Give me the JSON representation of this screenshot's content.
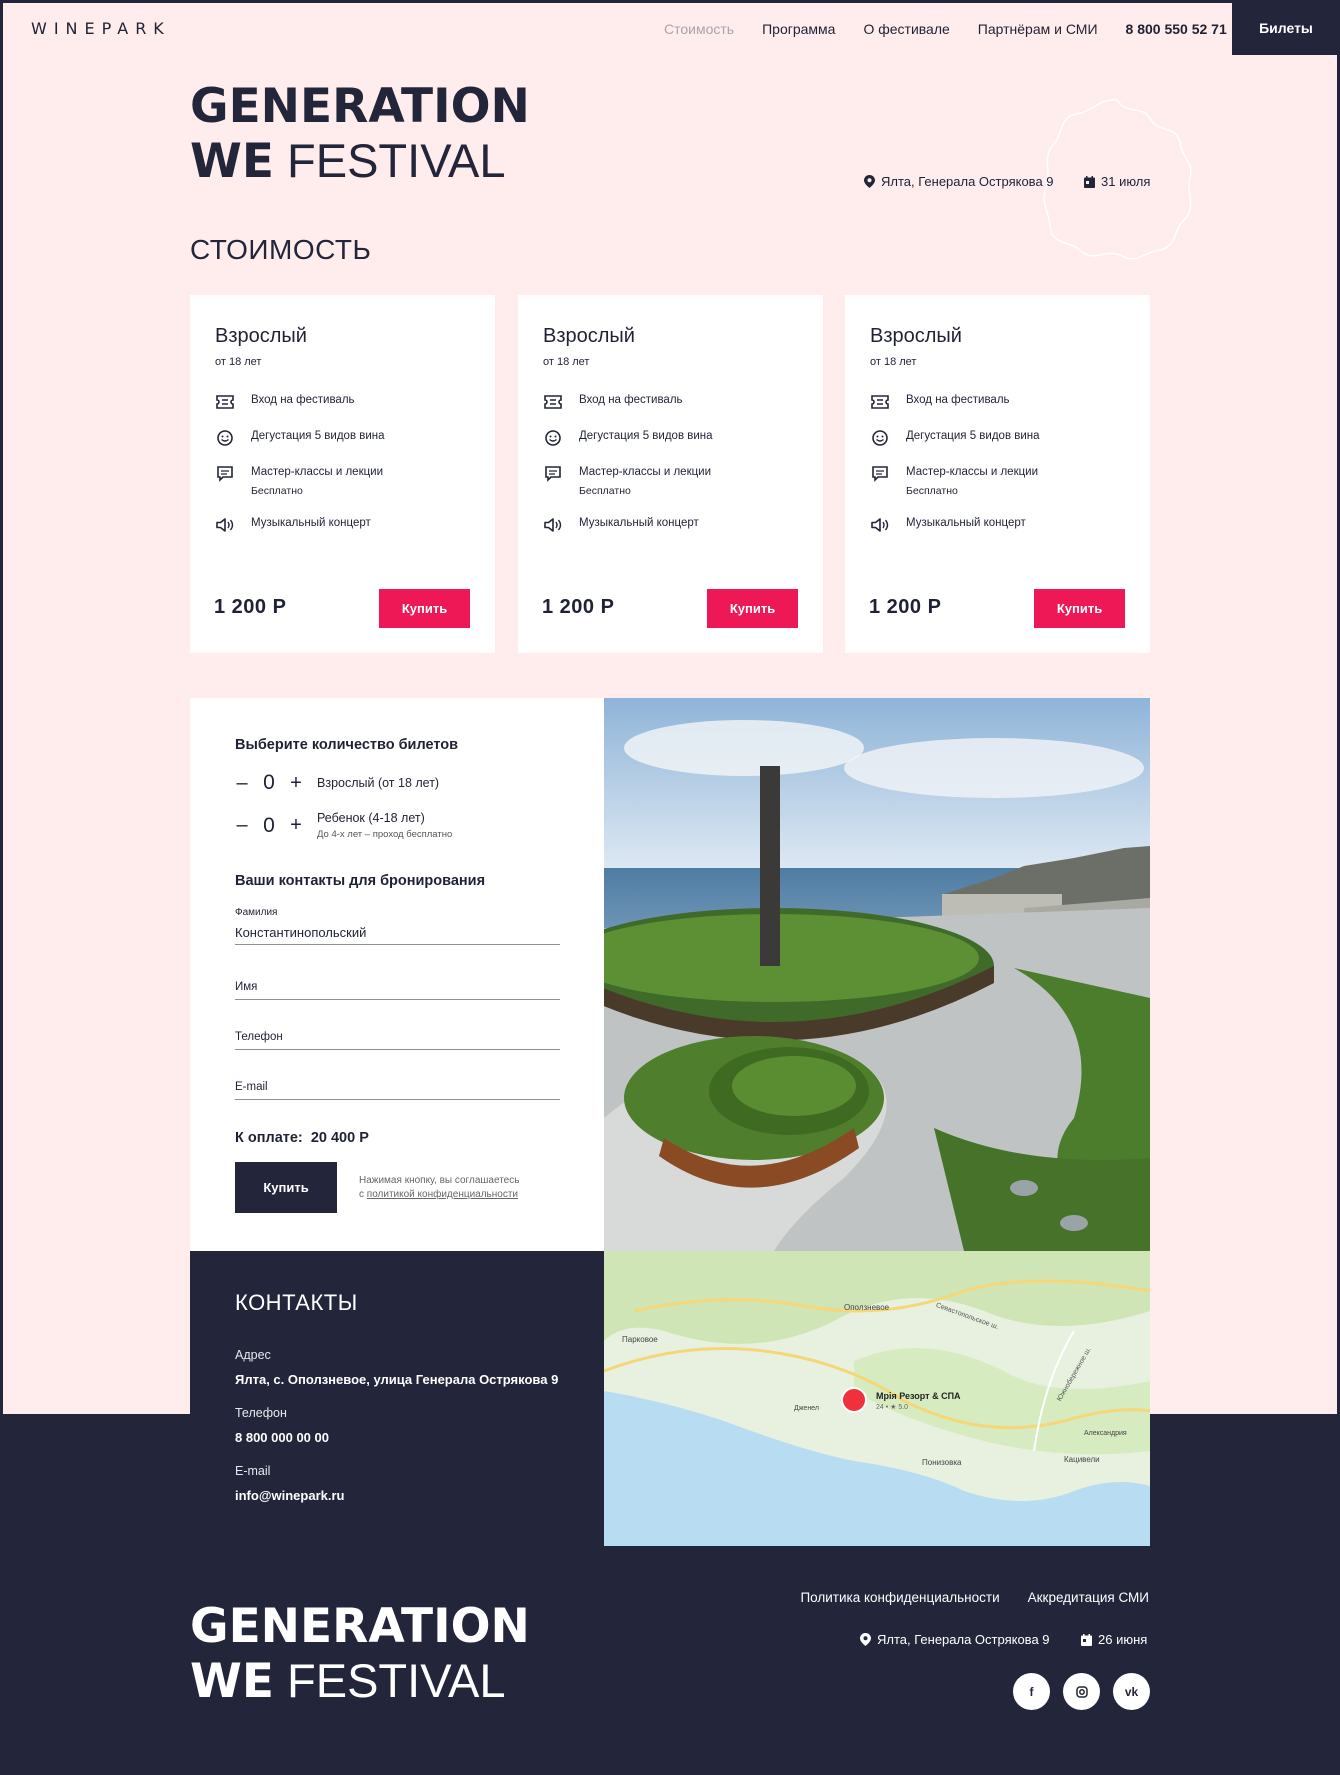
{
  "header": {
    "brand": "WINEPARK",
    "nav": [
      {
        "label": "Стоимость",
        "active": true
      },
      {
        "label": "Программа",
        "active": false
      },
      {
        "label": "О фестивале",
        "active": false
      },
      {
        "label": "Партнёрам и СМИ",
        "active": false
      }
    ],
    "phone": "8 800 550 52 71",
    "tickets_button": "Билеты"
  },
  "hero": {
    "logo_line1": "GENERATION",
    "logo_we": "WE",
    "logo_festival": "FESTIVAL",
    "location": "Ялта, Генерала Острякова 9",
    "date": "31 июля"
  },
  "pricing": {
    "title": "СТОИМОСТЬ",
    "cards": [
      {
        "title": "Взрослый",
        "subtitle": "от 18 лет",
        "features": [
          {
            "icon": "ticket-icon",
            "text": "Вход на фестиваль",
            "note": ""
          },
          {
            "icon": "smile-icon",
            "text": "Дегустация 5 видов вина",
            "note": ""
          },
          {
            "icon": "chat-icon",
            "text": "Мастер-классы и лекции",
            "note": "Бесплатно"
          },
          {
            "icon": "speaker-icon",
            "text": "Музыкальный концерт",
            "note": ""
          }
        ],
        "price": "1 200 Р",
        "buy_label": "Купить"
      },
      {
        "title": "Взрослый",
        "subtitle": "от 18 лет",
        "features": [
          {
            "icon": "ticket-icon",
            "text": "Вход на фестиваль",
            "note": ""
          },
          {
            "icon": "smile-icon",
            "text": "Дегустация 5 видов вина",
            "note": ""
          },
          {
            "icon": "chat-icon",
            "text": "Мастер-классы и лекции",
            "note": "Бесплатно"
          },
          {
            "icon": "speaker-icon",
            "text": "Музыкальный концерт",
            "note": ""
          }
        ],
        "price": "1 200 Р",
        "buy_label": "Купить"
      },
      {
        "title": "Взрослый",
        "subtitle": "от 18 лет",
        "features": [
          {
            "icon": "ticket-icon",
            "text": "Вход на фестиваль",
            "note": ""
          },
          {
            "icon": "smile-icon",
            "text": "Дегустация 5 видов вина",
            "note": ""
          },
          {
            "icon": "chat-icon",
            "text": "Мастер-классы и лекции",
            "note": "Бесплатно"
          },
          {
            "icon": "speaker-icon",
            "text": "Музыкальный концерт",
            "note": ""
          }
        ],
        "price": "1 200 Р",
        "buy_label": "Купить"
      }
    ]
  },
  "order": {
    "qty_title": "Выберите количество билетов",
    "quantities": [
      {
        "label": "Взрослый (от 18 лет)",
        "note": "",
        "value": "0"
      },
      {
        "label": "Ребенок (4-18 лет)",
        "note": "До 4-х лет – проход бесплатно",
        "value": "0"
      }
    ],
    "minus": "–",
    "plus": "+",
    "contacts_title": "Ваши контакты для бронирования",
    "fields": {
      "surname_label": "Фамилия",
      "surname_value": "Константинопольский",
      "name_placeholder": "Имя",
      "phone_placeholder": "Телефон",
      "email_placeholder": "E-mail"
    },
    "total_label": "К оплате:",
    "total_value": "20 400 Р",
    "buy_label": "Купить",
    "consent_text": "Нажимая кнопку, вы соглашаетесь",
    "consent_prefix": "с",
    "consent_link": "политикой конфиденциальности"
  },
  "contacts": {
    "title": "КОНТАКТЫ",
    "address_label": "Адрес",
    "address": "Ялта, с. Оползневое, улица Генерала Острякова 9",
    "phone_label": "Телефон",
    "phone": "8 800 000 00 00",
    "email_label": "E-mail",
    "email": "info@winepark.ru"
  },
  "map": {
    "labels": [
      "Оползневое",
      "Парковое",
      "Мрія Резорт & СПА",
      "24 • ★ 5.0",
      "Понизовка",
      "Кацивели",
      "Александрия",
      "Дженел"
    ],
    "road_labels": [
      "Севастопольское ш.",
      "Южнобережное ш."
    ],
    "colors": {
      "land": "#e8f1e0",
      "forest": "#cfe5b6",
      "sea": "#b8dcf2",
      "road": "#f5d77a",
      "pin": "#f0303a"
    }
  },
  "footer": {
    "links": [
      "Политика конфиденциальности",
      "Аккредитация СМИ"
    ],
    "location": "Ялта, Генерала Острякова 9",
    "date": "26 июня",
    "social": [
      {
        "icon": "facebook-icon",
        "label": "f"
      },
      {
        "icon": "instagram-icon",
        "label": ""
      },
      {
        "icon": "vk-icon",
        "label": "vk"
      }
    ]
  },
  "colors": {
    "accent": "#ee1856",
    "dark": "#23263a",
    "pink": "#ffecec"
  }
}
